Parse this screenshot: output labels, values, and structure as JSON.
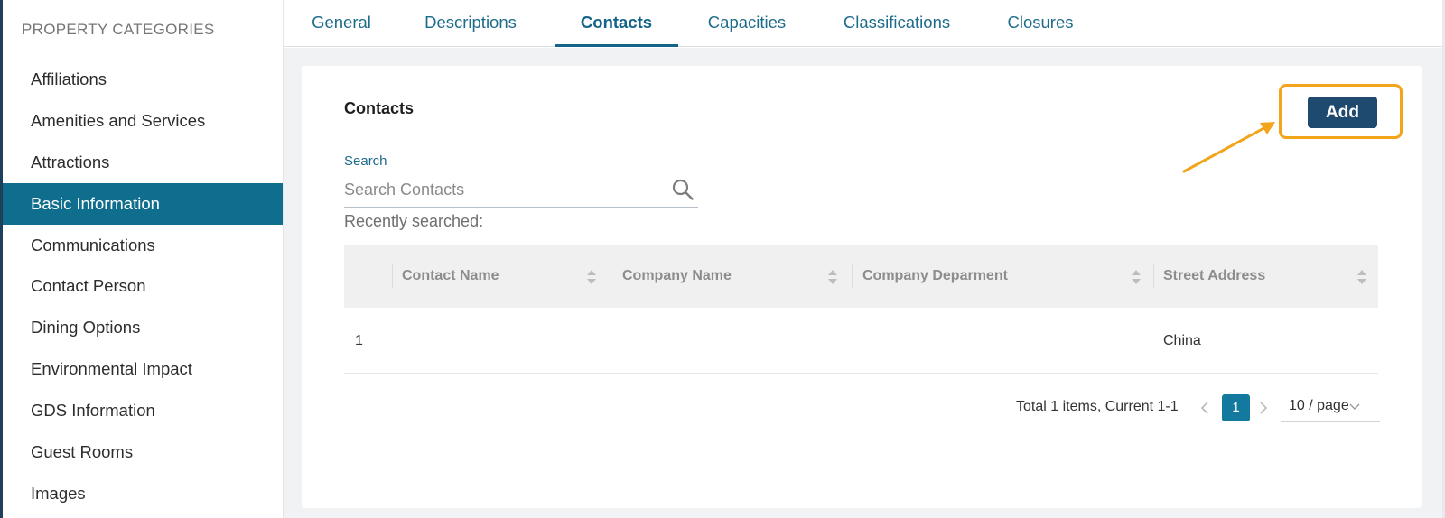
{
  "sidebar": {
    "header": "PROPERTY CATEGORIES",
    "items": [
      {
        "label": "Affiliations"
      },
      {
        "label": "Amenities and Services"
      },
      {
        "label": "Attractions"
      },
      {
        "label": "Basic Information",
        "active": true
      },
      {
        "label": "Communications"
      },
      {
        "label": "Contact Person"
      },
      {
        "label": "Dining Options"
      },
      {
        "label": "Environmental Impact"
      },
      {
        "label": "GDS Information"
      },
      {
        "label": "Guest Rooms"
      },
      {
        "label": "Images"
      }
    ]
  },
  "tabs": [
    {
      "label": "General"
    },
    {
      "label": "Descriptions"
    },
    {
      "label": "Contacts",
      "active": true
    },
    {
      "label": "Capacities"
    },
    {
      "label": "Classifications"
    },
    {
      "label": "Closures"
    }
  ],
  "contacts": {
    "title": "Contacts",
    "add_label": "Add",
    "search_label": "Search",
    "search_placeholder": "Search Contacts",
    "recent_label": "Recently searched:"
  },
  "table": {
    "columns": [
      "Contact Name",
      "Company Name",
      "Company Deparment",
      "Street Address"
    ],
    "rows": [
      {
        "index": "1",
        "contact_name": "",
        "company_name": "",
        "company_department": "",
        "street_address": "China"
      }
    ]
  },
  "pagination": {
    "total_text": "Total 1 items, Current 1-1",
    "current_page": "1",
    "page_size": "10 / page"
  },
  "colors": {
    "accent": "#0f6e8e",
    "add_button": "#1d4a6e",
    "highlight": "#f2a51b"
  }
}
